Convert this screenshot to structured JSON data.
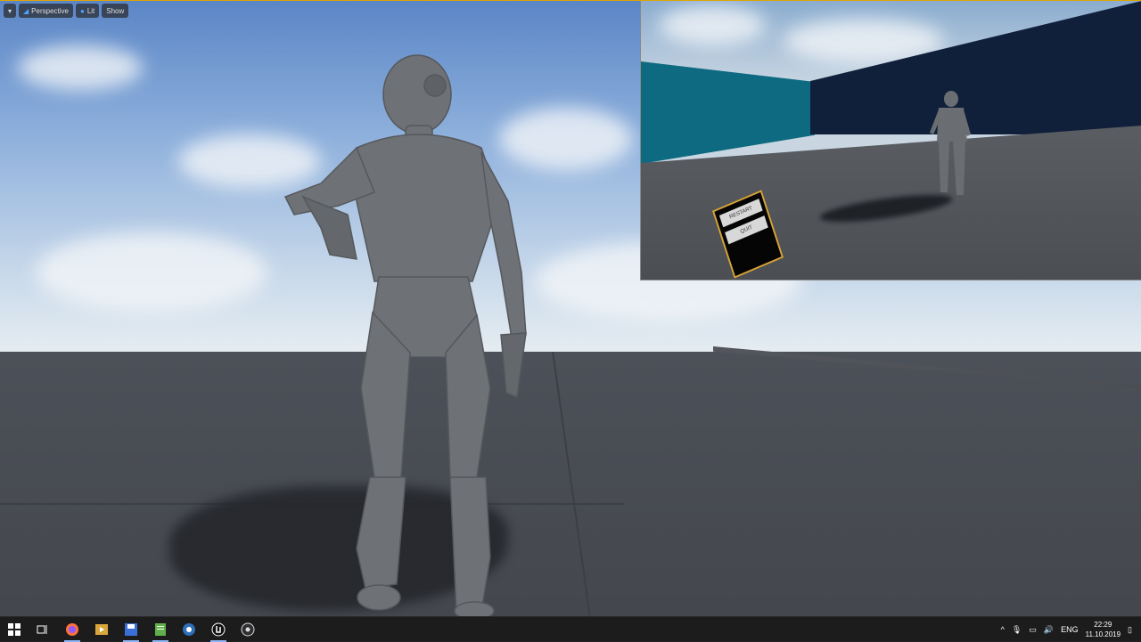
{
  "viewport_toolbar": {
    "menu_glyph": "▾",
    "perspective": "Perspective",
    "lit": "Lit",
    "show": "Show"
  },
  "pip_widget": {
    "restart": "RESTART",
    "quit": "QUIT"
  },
  "taskbar": {
    "icons": [
      "windows-start-icon",
      "task-view-icon",
      "firefox-icon",
      "media-player-icon",
      "save-disk-icon",
      "notepad-icon",
      "app-circle-icon",
      "unreal-engine-icon",
      "obs-icon"
    ],
    "tray": {
      "chevron": "^",
      "lang": "ENG",
      "time": "22:29",
      "date": "11.10.2019"
    }
  },
  "colors": {
    "accent_border": "#e0a500",
    "widget_border": "#d6a43a",
    "teal_wall": "#0e6a80"
  }
}
